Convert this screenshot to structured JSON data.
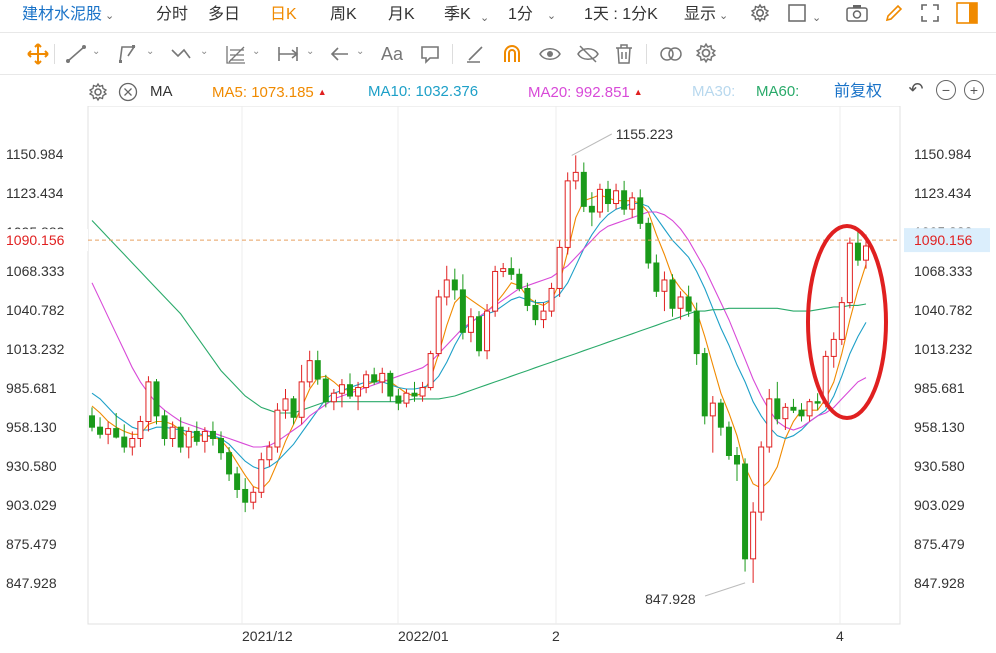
{
  "toolbar": {
    "stock_name": "建材水泥股",
    "periods": [
      "分时",
      "多日",
      "日K",
      "周K",
      "月K",
      "季K"
    ],
    "active_period": "日K",
    "interval": "1分",
    "day_interval": "1天 : 1分K",
    "display": "显示"
  },
  "drawing_tools": [
    "move-icon",
    "line-icon",
    "polyline-icon",
    "zigzag-icon",
    "fib-icon",
    "range-icon",
    "arrow-icon",
    "text-icon",
    "comment-icon",
    "eraser-icon",
    "magnet-icon",
    "eye-icon",
    "hide-icon",
    "trash-icon",
    "compare-icon",
    "settings-icon"
  ],
  "ma_bar": {
    "indicator": "MA",
    "ma5": {
      "label": "MA5:",
      "value": "1073.185",
      "color": "#f08a00"
    },
    "ma10": {
      "label": "MA10:",
      "value": "1032.376",
      "color": "#1ea0c8"
    },
    "ma20": {
      "label": "MA20:",
      "value": "992.851",
      "color": "#d84ad8"
    },
    "ma30": {
      "label": "MA30:",
      "color": "#b8d8ee"
    },
    "ma60": {
      "label": "MA60:",
      "color": "#2aaa6a"
    },
    "adjust": "前复权"
  },
  "chart_data": {
    "type": "candlestick",
    "y_ticks": [
      "1150.984",
      "1123.434",
      "1095.883",
      "1068.333",
      "1040.782",
      "1013.232",
      "985.681",
      "958.130",
      "930.580",
      "903.029",
      "875.479",
      "847.928"
    ],
    "ylim": [
      847.928,
      1150.984
    ],
    "x_ticks": [
      "2021/12",
      "2022/01",
      "2",
      "4"
    ],
    "current_price": "1090.156",
    "max_label": "1155.223",
    "min_label": "847.928",
    "colors": {
      "up": "#e02020",
      "down": "#1a9a1a",
      "current": "#e8a060"
    },
    "candles": [
      [
        966,
        972,
        955,
        958
      ],
      [
        958,
        965,
        950,
        953
      ],
      [
        953,
        962,
        946,
        957
      ],
      [
        957,
        968,
        950,
        951
      ],
      [
        951,
        960,
        940,
        944
      ],
      [
        944,
        955,
        938,
        950
      ],
      [
        950,
        966,
        944,
        962
      ],
      [
        962,
        994,
        955,
        990
      ],
      [
        990,
        992,
        960,
        966
      ],
      [
        966,
        970,
        945,
        950
      ],
      [
        950,
        962,
        944,
        958
      ],
      [
        958,
        965,
        940,
        944
      ],
      [
        944,
        958,
        936,
        955
      ],
      [
        955,
        962,
        945,
        948
      ],
      [
        948,
        958,
        940,
        955
      ],
      [
        955,
        962,
        945,
        950
      ],
      [
        950,
        955,
        935,
        940
      ],
      [
        940,
        944,
        920,
        925
      ],
      [
        925,
        930,
        908,
        914
      ],
      [
        914,
        922,
        898,
        905
      ],
      [
        905,
        916,
        900,
        912
      ],
      [
        912,
        940,
        908,
        935
      ],
      [
        935,
        948,
        930,
        944
      ],
      [
        944,
        975,
        940,
        970
      ],
      [
        970,
        985,
        964,
        978
      ],
      [
        978,
        980,
        960,
        965
      ],
      [
        965,
        1002,
        960,
        990
      ],
      [
        990,
        1012,
        986,
        1005
      ],
      [
        1005,
        1012,
        988,
        992
      ],
      [
        992,
        995,
        972,
        976
      ],
      [
        976,
        985,
        970,
        982
      ],
      [
        982,
        992,
        972,
        988
      ],
      [
        988,
        996,
        978,
        980
      ],
      [
        980,
        990,
        970,
        986
      ],
      [
        986,
        998,
        982,
        995
      ],
      [
        995,
        1000,
        988,
        990
      ],
      [
        990,
        1000,
        982,
        996
      ],
      [
        996,
        998,
        976,
        980
      ],
      [
        980,
        985,
        970,
        975
      ],
      [
        975,
        985,
        972,
        982
      ],
      [
        982,
        990,
        976,
        980
      ],
      [
        980,
        990,
        976,
        986
      ],
      [
        986,
        1012,
        984,
        1010
      ],
      [
        1010,
        1055,
        1008,
        1050
      ],
      [
        1050,
        1072,
        1044,
        1062
      ],
      [
        1062,
        1070,
        1048,
        1055
      ],
      [
        1055,
        1066,
        1020,
        1025
      ],
      [
        1025,
        1042,
        1018,
        1036
      ],
      [
        1036,
        1040,
        1008,
        1012
      ],
      [
        1012,
        1045,
        1006,
        1040
      ],
      [
        1040,
        1072,
        1036,
        1068
      ],
      [
        1068,
        1074,
        1064,
        1070
      ],
      [
        1070,
        1078,
        1062,
        1066
      ],
      [
        1066,
        1070,
        1054,
        1056
      ],
      [
        1056,
        1060,
        1040,
        1044
      ],
      [
        1044,
        1048,
        1030,
        1034
      ],
      [
        1034,
        1046,
        1028,
        1040
      ],
      [
        1040,
        1060,
        1036,
        1056
      ],
      [
        1056,
        1090,
        1050,
        1085
      ],
      [
        1085,
        1138,
        1080,
        1132
      ],
      [
        1132,
        1150,
        1126,
        1138
      ],
      [
        1138,
        1145,
        1110,
        1114
      ],
      [
        1114,
        1124,
        1100,
        1110
      ],
      [
        1110,
        1130,
        1106,
        1126
      ],
      [
        1126,
        1132,
        1110,
        1116
      ],
      [
        1116,
        1130,
        1112,
        1125
      ],
      [
        1125,
        1132,
        1108,
        1112
      ],
      [
        1112,
        1124,
        1106,
        1120
      ],
      [
        1120,
        1126,
        1098,
        1102
      ],
      [
        1102,
        1106,
        1070,
        1074
      ],
      [
        1074,
        1080,
        1050,
        1054
      ],
      [
        1054,
        1068,
        1040,
        1062
      ],
      [
        1062,
        1066,
        1036,
        1042
      ],
      [
        1042,
        1054,
        1034,
        1050
      ],
      [
        1050,
        1058,
        1036,
        1040
      ],
      [
        1040,
        1046,
        1002,
        1010
      ],
      [
        1010,
        1014,
        960,
        966
      ],
      [
        966,
        980,
        940,
        975
      ],
      [
        975,
        978,
        952,
        958
      ],
      [
        958,
        962,
        935,
        938
      ],
      [
        938,
        944,
        920,
        932
      ],
      [
        932,
        936,
        856,
        865
      ],
      [
        865,
        905,
        848,
        898
      ],
      [
        898,
        948,
        892,
        944
      ],
      [
        944,
        985,
        940,
        978
      ],
      [
        978,
        990,
        960,
        964
      ],
      [
        964,
        975,
        956,
        972
      ],
      [
        972,
        978,
        968,
        970
      ],
      [
        970,
        975,
        962,
        966
      ],
      [
        966,
        978,
        962,
        976
      ],
      [
        976,
        982,
        970,
        975
      ],
      [
        975,
        1012,
        972,
        1008
      ],
      [
        1008,
        1025,
        1000,
        1020
      ],
      [
        1020,
        1050,
        1016,
        1046
      ],
      [
        1046,
        1092,
        1042,
        1088
      ],
      [
        1088,
        1098,
        1072,
        1076
      ],
      [
        1076,
        1094,
        1070,
        1086
      ]
    ],
    "ma": {
      "ma5": [
        973,
        968,
        962,
        958,
        955,
        953,
        953,
        960,
        962,
        962,
        960,
        956,
        950,
        952,
        952,
        951,
        949,
        942,
        933,
        924,
        916,
        914,
        920,
        933,
        948,
        960,
        972,
        985,
        993,
        994,
        990,
        985,
        984,
        985,
        988,
        990,
        992,
        990,
        986,
        982,
        980,
        982,
        992,
        1010,
        1030,
        1046,
        1052,
        1048,
        1044,
        1040,
        1045,
        1052,
        1060,
        1058,
        1050,
        1046,
        1044,
        1048,
        1060,
        1082,
        1106,
        1118,
        1120,
        1122,
        1120,
        1118,
        1118,
        1118,
        1116,
        1110,
        1094,
        1080,
        1064,
        1056,
        1050,
        1040,
        1022,
        1002,
        982,
        968,
        952,
        930,
        918,
        915,
        920,
        930,
        950,
        962,
        970,
        970,
        970,
        978,
        990,
        1010,
        1034,
        1055,
        1073
      ],
      "ma10": [
        982,
        978,
        972,
        966,
        962,
        958,
        956,
        956,
        958,
        958,
        957,
        956,
        955,
        954,
        952,
        952,
        950,
        946,
        940,
        934,
        930,
        928,
        930,
        934,
        940,
        946,
        954,
        962,
        970,
        978,
        982,
        984,
        986,
        988,
        990,
        990,
        990,
        988,
        986,
        985,
        985,
        986,
        988,
        994,
        1004,
        1016,
        1026,
        1032,
        1036,
        1038,
        1040,
        1044,
        1048,
        1050,
        1048,
        1046,
        1046,
        1048,
        1052,
        1060,
        1072,
        1084,
        1094,
        1102,
        1108,
        1112,
        1114,
        1116,
        1116,
        1114,
        1106,
        1098,
        1090,
        1084,
        1078,
        1068,
        1056,
        1042,
        1028,
        1016,
        1002,
        990,
        976,
        966,
        958,
        952,
        950,
        952,
        956,
        962,
        966,
        970,
        980,
        994,
        1010,
        1022,
        1032
      ],
      "ma20": [
        1060,
        1048,
        1036,
        1024,
        1012,
        1000,
        990,
        982,
        975,
        970,
        966,
        962,
        960,
        958,
        956,
        954,
        952,
        950,
        948,
        946,
        944,
        944,
        945,
        948,
        952,
        956,
        960,
        966,
        970,
        974,
        978,
        980,
        982,
        984,
        986,
        988,
        990,
        992,
        994,
        996,
        998,
        1000,
        1004,
        1010,
        1016,
        1022,
        1028,
        1032,
        1036,
        1040,
        1044,
        1048,
        1052,
        1056,
        1058,
        1060,
        1062,
        1064,
        1068,
        1072,
        1078,
        1084,
        1090,
        1096,
        1100,
        1102,
        1104,
        1106,
        1108,
        1110,
        1110,
        1108,
        1104,
        1098,
        1090,
        1080,
        1070,
        1058,
        1046,
        1034,
        1020,
        1006,
        992,
        980,
        970,
        962,
        958,
        956,
        958,
        962,
        966,
        968,
        972,
        978,
        984,
        990,
        993
      ],
      "ma60": [
        1104,
        1098,
        1092,
        1086,
        1080,
        1074,
        1068,
        1062,
        1056,
        1050,
        1044,
        1038,
        1030,
        1022,
        1014,
        1006,
        998,
        992,
        986,
        980,
        976,
        972,
        970,
        968,
        968,
        968,
        970,
        972,
        974,
        976,
        976,
        976,
        976,
        976,
        976,
        976,
        976,
        976,
        976,
        977,
        978,
        978,
        978,
        978,
        979,
        980,
        982,
        984,
        986,
        988,
        990,
        992,
        994,
        996,
        998,
        1000,
        1002,
        1004,
        1006,
        1008,
        1010,
        1012,
        1014,
        1016,
        1018,
        1020,
        1022,
        1024,
        1026,
        1028,
        1030,
        1032,
        1034,
        1036,
        1038,
        1040,
        1040,
        1041,
        1041,
        1042,
        1042,
        1042,
        1042,
        1042,
        1042,
        1042,
        1041,
        1040,
        1040,
        1040,
        1041,
        1042,
        1043,
        1043,
        1044,
        1044,
        1045
      ]
    }
  }
}
